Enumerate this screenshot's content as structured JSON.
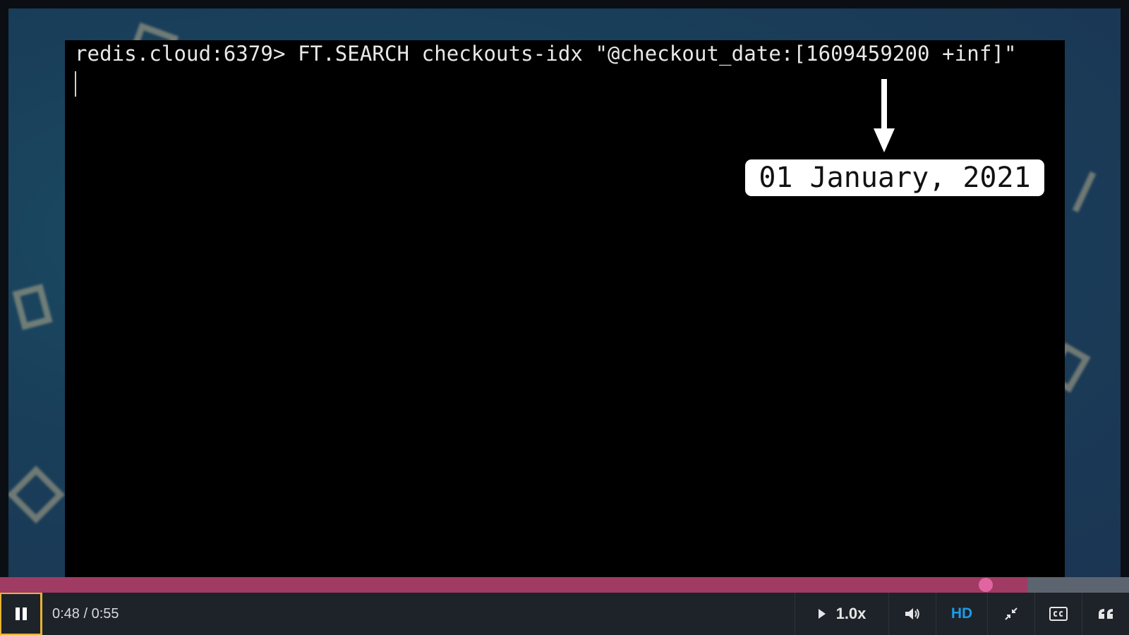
{
  "terminal": {
    "command_line": "redis.cloud:6379> FT.SEARCH checkouts-idx \"@checkout_date:[1609459200 +inf]\"",
    "annotation": "01 January, 2021"
  },
  "player": {
    "time_display": "0:48 / 0:55",
    "played_fraction": 0.873,
    "buffered_fraction": 0.91,
    "speed_label": "1.0x",
    "quality_label": "HD",
    "accent_color": "#a03b64",
    "thumb_color": "#e065a0",
    "focus_color": "#e8b331",
    "hd_color": "#1e9be8"
  },
  "icons": [
    "pause-icon",
    "play-icon",
    "volume-icon",
    "exit-fullscreen-icon",
    "closed-captions-icon",
    "transcript-icon"
  ]
}
